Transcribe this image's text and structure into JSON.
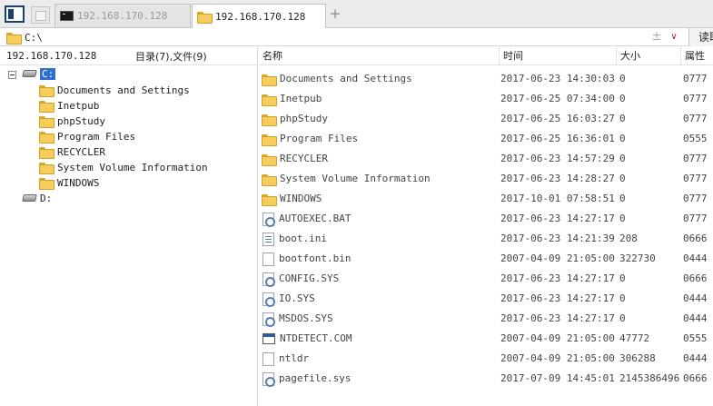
{
  "tabs": [
    {
      "label": "192.168.170.128",
      "icon": "terminal-icon",
      "active": false
    },
    {
      "label": "192.168.170.128",
      "icon": "folder-icon",
      "active": true
    }
  ],
  "address": {
    "value": "C:\\",
    "read_label": "读取"
  },
  "left": {
    "host": "192.168.170.128",
    "count_label": "目录(7),文件(9)",
    "drive_c": "C:",
    "drive_d": "D:",
    "folders": [
      "Documents and Settings",
      "Inetpub",
      "phpStudy",
      "Program Files",
      "RECYCLER",
      "System Volume Information",
      "WINDOWS"
    ]
  },
  "columns": {
    "name": "名称",
    "time": "时间",
    "size": "大小",
    "attr": "属性"
  },
  "files": [
    {
      "name": "Documents and Settings",
      "time": "2017-06-23 14:30:03",
      "size": "0",
      "attr": "0777",
      "icon": "folder-icon"
    },
    {
      "name": "Inetpub",
      "time": "2017-06-25 07:34:00",
      "size": "0",
      "attr": "0777",
      "icon": "folder-icon"
    },
    {
      "name": "phpStudy",
      "time": "2017-06-25 16:03:27",
      "size": "0",
      "attr": "0777",
      "icon": "folder-icon"
    },
    {
      "name": "Program Files",
      "time": "2017-06-25 16:36:01",
      "size": "0",
      "attr": "0555",
      "icon": "folder-icon"
    },
    {
      "name": "RECYCLER",
      "time": "2017-06-23 14:57:29",
      "size": "0",
      "attr": "0777",
      "icon": "folder-icon"
    },
    {
      "name": "System Volume Information",
      "time": "2017-06-23 14:28:27",
      "size": "0",
      "attr": "0777",
      "icon": "folder-icon"
    },
    {
      "name": "WINDOWS",
      "time": "2017-10-01 07:58:51",
      "size": "0",
      "attr": "0777",
      "icon": "folder-icon"
    },
    {
      "name": "AUTOEXEC.BAT",
      "time": "2017-06-23 14:27:17",
      "size": "0",
      "attr": "0777",
      "icon": "batch-file-icon"
    },
    {
      "name": "boot.ini",
      "time": "2017-06-23 14:21:39",
      "size": "208",
      "attr": "0666",
      "icon": "config-file-icon"
    },
    {
      "name": "bootfont.bin",
      "time": "2007-04-09 21:05:00",
      "size": "322730",
      "attr": "0444",
      "icon": "blank-file-icon"
    },
    {
      "name": "CONFIG.SYS",
      "time": "2017-06-23 14:27:17",
      "size": "0",
      "attr": "0666",
      "icon": "system-file-icon"
    },
    {
      "name": "IO.SYS",
      "time": "2017-06-23 14:27:17",
      "size": "0",
      "attr": "0444",
      "icon": "system-file-icon"
    },
    {
      "name": "MSDOS.SYS",
      "time": "2017-06-23 14:27:17",
      "size": "0",
      "attr": "0444",
      "icon": "system-file-icon"
    },
    {
      "name": "NTDETECT.COM",
      "time": "2007-04-09 21:05:00",
      "size": "47772",
      "attr": "0555",
      "icon": "application-file-icon"
    },
    {
      "name": "ntldr",
      "time": "2007-04-09 21:05:00",
      "size": "306288",
      "attr": "0444",
      "icon": "blank-file-icon"
    },
    {
      "name": "pagefile.sys",
      "time": "2017-07-09 14:45:01",
      "size": "2145386496",
      "attr": "0666",
      "icon": "system-file-icon"
    }
  ]
}
